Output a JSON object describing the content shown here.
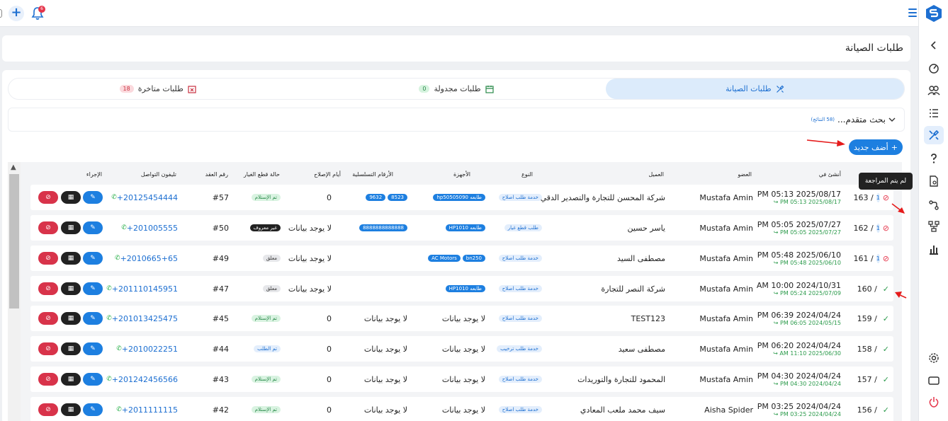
{
  "topbar": {
    "add_icon": "plus-icon",
    "notif_count": "6"
  },
  "page": {
    "title": "طلبات الصيانة"
  },
  "tabs": [
    {
      "label": "طلبات الصيانة",
      "count": "",
      "active": true
    },
    {
      "label": "طلبات مجدولة",
      "count": "0",
      "active": false
    },
    {
      "label": "طلبات متاخرة",
      "count": "18",
      "active": false
    }
  ],
  "search": {
    "label": "بحث متقدم...",
    "count": "(58 النتائج)"
  },
  "add_button": {
    "label": "أضف جديد"
  },
  "tooltip": {
    "text": "لم يتم المراجعة"
  },
  "columns": {
    "created": "أنشئ في",
    "member": "العضو",
    "client": "العميل",
    "type": "النوع",
    "devices": "الأجهزة",
    "serials": "الأرقام التسلسلية",
    "repair_days": "أيام الإصلاح",
    "parts_status": "حالة قطع الغيار",
    "contract": "رقم العقد",
    "phone": "تليفون التواصل",
    "action": "الإجراء"
  },
  "rows": [
    {
      "id": "163 /",
      "badge": "1",
      "status": "bad",
      "date": "PM 05:13 2025/08/17",
      "date_sub": "↪ PM 05:13 2025/08/17",
      "member": "Mustafa Amin",
      "client": "شركة المحسن للتجارة والتصدير الدقي",
      "type": "خدمة طلب اصلاح",
      "devices": [
        "طابعه hp50505090"
      ],
      "serials": [
        "8523",
        "9632"
      ],
      "days": "0",
      "parts": "تم الإستلام",
      "parts_style": "green",
      "contract": "#57",
      "phone": "+20125454444"
    },
    {
      "id": "162 /",
      "badge": "1",
      "status": "bad",
      "date": "PM 05:05 2025/07/27",
      "date_sub": "↪ PM 05:05 2025/07/27",
      "member": "Mustafa Amin",
      "client": "ياسر حسين",
      "type": "طلب قطع غيار",
      "devices": [
        "طابعه HP1010"
      ],
      "serials": [
        "8888888888888"
      ],
      "days": "لا يوجد بيانات",
      "parts": "غير معروف",
      "parts_style": "dark",
      "contract": "#50",
      "phone": "+201005555"
    },
    {
      "id": "161 /",
      "badge": "1",
      "status": "bad",
      "date": "PM 05:48 2025/06/10",
      "date_sub": "↪ PM 05:48 2025/06/10",
      "member": "Mustafa Amin",
      "client": "مصطفى السيد",
      "type": "خدمة طلب اصلاح",
      "devices": [
        "bn250",
        "AC Motors"
      ],
      "serials": [],
      "days": "لا يوجد بيانات",
      "parts": "معلق",
      "parts_style": "grey",
      "contract": "#49",
      "phone": "+2010665+65"
    },
    {
      "id": "160 /",
      "badge": "",
      "status": "ok",
      "date": "AM 10:00 2024/10/31",
      "date_sub": "↪ PM 05:24 2025/07/09",
      "member": "Mustafa Amin",
      "client": "شركة النصر للتجارة",
      "type": "خدمة طلب اصلاح",
      "devices": [
        "طابعه HP1010"
      ],
      "serials": [],
      "days": "لا يوجد بيانات",
      "parts": "معلق",
      "parts_style": "grey",
      "contract": "#47",
      "phone": "+201110145951"
    },
    {
      "id": "159 /",
      "badge": "",
      "status": "ok",
      "date": "PM 06:39 2024/04/24",
      "date_sub": "↪ PM 06:05 2024/05/15",
      "member": "Mustafa Amin",
      "client": "TEST123",
      "type": "خدمة طلب اصلاح",
      "devices_text": "لا يوجد بيانات",
      "serials_text": "لا يوجد بيانات",
      "days": "0",
      "parts": "تم الإستلام",
      "parts_style": "green",
      "contract": "#45",
      "phone": "+201013425475"
    },
    {
      "id": "158 /",
      "badge": "",
      "status": "ok",
      "date": "PM 06:20 2024/04/24",
      "date_sub": "↪ AM 11:10 2025/06/30",
      "member": "Mustafa Amin",
      "client": "مصطفى سعيد",
      "type": "خدمة طلب ترخيب",
      "devices_text": "لا يوجد بيانات",
      "serials_text": "لا يوجد بيانات",
      "days": "0",
      "parts": "تم الطلب",
      "parts_style": "light",
      "contract": "#44",
      "phone": "+2010022251"
    },
    {
      "id": "157 /",
      "badge": "",
      "status": "ok",
      "date": "PM 04:30 2024/04/24",
      "date_sub": "↪ PM 04:30 2024/04/24",
      "member": "Mustafa Amin",
      "client": "المحمود للتجارة والتوريدات",
      "type": "خدمة طلب اصلاح",
      "devices_text": "لا يوجد بيانات",
      "serials_text": "لا يوجد بيانات",
      "days": "0",
      "parts": "تم الإستلام",
      "parts_style": "green",
      "contract": "#43",
      "phone": "+201242456566"
    },
    {
      "id": "156 /",
      "badge": "",
      "status": "ok",
      "date": "PM 03:25 2024/04/24",
      "date_sub": "↪ PM 03:25 2024/04/24",
      "member": "Aisha Spider",
      "client": "سيف محمد ملعب المعادي",
      "type": "خدمة طلب اصلاح",
      "devices_text": "لا يوجد بيانات",
      "serials_text": "لا يوجد بيانات",
      "days": "0",
      "parts": "تم الإستلام",
      "parts_style": "green",
      "contract": "#42",
      "phone": "+2011111115"
    }
  ]
}
